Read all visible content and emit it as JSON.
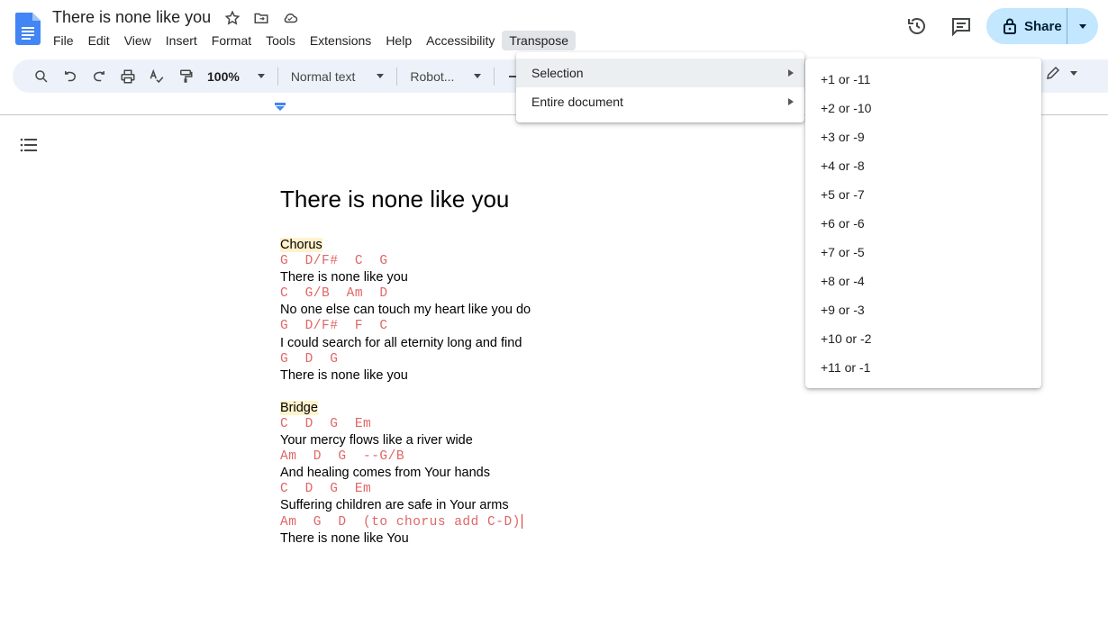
{
  "header": {
    "title": "There is none like you",
    "share_label": "Share"
  },
  "menubar": [
    "File",
    "Edit",
    "View",
    "Insert",
    "Format",
    "Tools",
    "Extensions",
    "Help",
    "Accessibility",
    "Transpose"
  ],
  "toolbar": {
    "zoom": "100%",
    "style": "Normal text",
    "font": "Robot..."
  },
  "document": {
    "title": "There is none like you",
    "lines": [
      {
        "type": "section",
        "text": "Chorus"
      },
      {
        "type": "chord",
        "text": "G  D/F#  C  G"
      },
      {
        "type": "lyric",
        "text": "There is none like you"
      },
      {
        "type": "chord",
        "text": "C  G/B  Am  D"
      },
      {
        "type": "lyric",
        "text": "No one else can touch my heart like you do"
      },
      {
        "type": "chord",
        "text": "G  D/F#  F  C"
      },
      {
        "type": "lyric",
        "text": "I could search for all eternity long and find"
      },
      {
        "type": "chord",
        "text": "G  D  G"
      },
      {
        "type": "lyric",
        "text": "There is none like you"
      },
      {
        "type": "blank",
        "text": ""
      },
      {
        "type": "section",
        "text": "Bridge"
      },
      {
        "type": "chord",
        "text": "C  D  G  Em"
      },
      {
        "type": "lyric",
        "text": "Your mercy flows like a river wide"
      },
      {
        "type": "chord",
        "text": "Am  D  G  --G/B"
      },
      {
        "type": "lyric",
        "text": "And healing comes from Your hands"
      },
      {
        "type": "chord",
        "text": "C  D  G  Em"
      },
      {
        "type": "lyric",
        "text": "Suffering children are safe in Your arms"
      },
      {
        "type": "chord",
        "text": "Am  G  D  (to chorus add C-D)",
        "cursor": true
      },
      {
        "type": "lyric",
        "text": "There is none like You"
      }
    ]
  },
  "transpose_menu": {
    "items": [
      {
        "label": "Selection",
        "highlighted": true
      },
      {
        "label": "Entire document",
        "highlighted": false
      }
    ]
  },
  "selection_submenu": {
    "items": [
      "+1 or -11",
      "+2 or -10",
      "+3 or -9",
      "+4 or -8",
      "+5 or -7",
      "+6 or -6",
      "+7 or -5",
      "+8 or -4",
      "+9 or -3",
      "+10 or -2",
      "+11 or -1"
    ]
  },
  "colors": {
    "chord": "#e06666",
    "section_highlight": "#fff2cc",
    "share_bg": "#c2e7ff",
    "toolbar_bg": "#edf2fa",
    "docs_blue": "#4285f4"
  }
}
